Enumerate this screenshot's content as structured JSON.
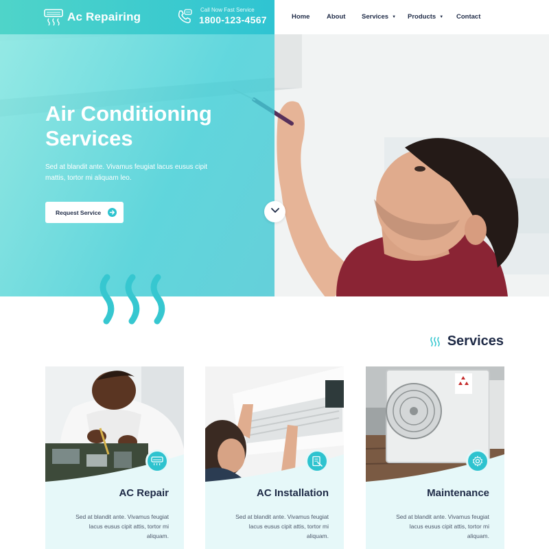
{
  "header": {
    "logo_text": "Ac Repairing",
    "logo_icon": "air-conditioner-icon",
    "call_label": "Call Now Fast Service",
    "call_number": "1800-123-4567",
    "call_icon": "phone-chat-icon",
    "accent_color": "#2ec3cf"
  },
  "nav": {
    "items": [
      {
        "label": "Home"
      },
      {
        "label": "About"
      },
      {
        "label": "Services",
        "has_dropdown": true
      },
      {
        "label": "Products",
        "has_dropdown": true
      },
      {
        "label": "Contact"
      }
    ]
  },
  "hero": {
    "title_line1": "Air Conditioning",
    "title_line2": "Services",
    "description": "Sed at blandit ante. Vivamus feugiat lacus eusus cipit mattis, tortor mi aliquam leo.",
    "button_label": "Request Service",
    "button_icon": "arrow-right-circle-icon",
    "scroll_icon": "chevron-down-icon"
  },
  "services": {
    "heading": "Services",
    "heading_icon": "waves-icon",
    "cards": [
      {
        "title": "AC Repair",
        "text": "Sed at blandit ante. Vivamus feugiat lacus eusus cipit attis, tortor mi aliquam.",
        "icon": "air-conditioner-icon"
      },
      {
        "title": "AC Installation",
        "text": "Sed at blandit ante. Vivamus feugiat lacus eusus cipit attis, tortor mi aliquam.",
        "icon": "checklist-tool-icon"
      },
      {
        "title": "Maintenance",
        "text": "Sed at blandit ante. Vivamus feugiat lacus eusus cipit attis, tortor mi aliquam.",
        "icon": "gear-icon"
      }
    ]
  }
}
